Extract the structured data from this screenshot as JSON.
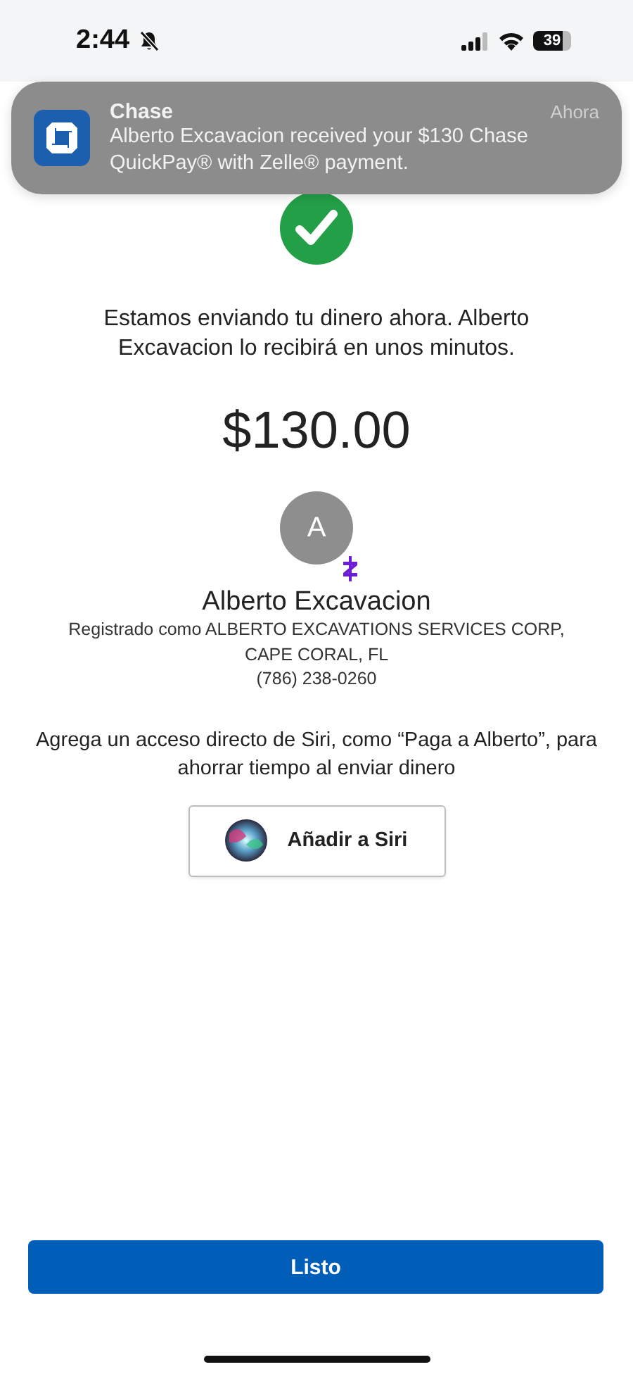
{
  "status_bar": {
    "time": "2:44",
    "silent": true,
    "battery": "39"
  },
  "notification": {
    "app": "Chase",
    "time": "Ahora",
    "message": "Alberto Excavacion received your $130 Chase QuickPay® with Zelle® payment."
  },
  "confirmation": {
    "message": "Estamos enviando tu dinero ahora. Alberto Excavacion lo recibirá en unos minutos.",
    "amount": "$130.00"
  },
  "recipient": {
    "initial": "A",
    "name": "Alberto Excavacion",
    "details": [
      "Registrado como ALBERTO EXCAVATIONS SERVICES CORP,",
      "CAPE CORAL, FL",
      "(786) 238-0260"
    ]
  },
  "siri": {
    "prompt": "Agrega un acceso directo de Siri, como “Paga a Alberto”, para ahorrar tiempo al enviar dinero",
    "button": "Añadir a Siri"
  },
  "done_button": "Listo"
}
